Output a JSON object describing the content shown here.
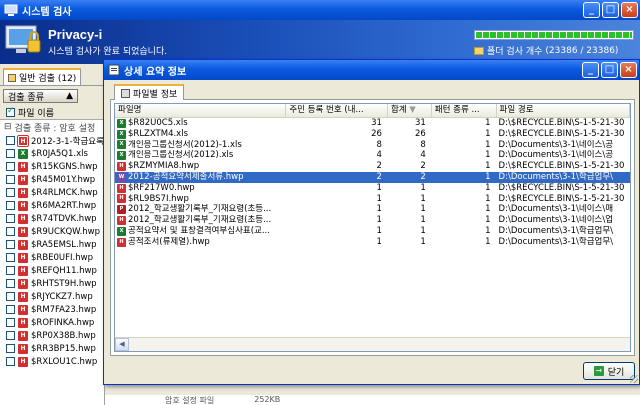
{
  "main_window": {
    "title": "시스템 검사",
    "buttons": [
      "_",
      "□",
      "×"
    ]
  },
  "banner": {
    "app_name": "Privacy-i",
    "status": "시스템 검사가 완료 되었습니다.",
    "progress_fraction": 1.0,
    "folder_count_label": "폴더 검사 개수",
    "folder_count_value": "(23386 / 23386)"
  },
  "left_panel": {
    "tab_label": "일반 검출 (12)",
    "sort_button": "검출 종류",
    "check_label": "파일 이름",
    "group_label": "검출 종류 : 암호 설정",
    "items": [
      {
        "name": "2012-3-1-학급요록.",
        "type": "hwp2"
      },
      {
        "name": "$R0JA5Q1.xls",
        "type": "xls"
      },
      {
        "name": "$R15KGNS.hwp",
        "type": "hwp"
      },
      {
        "name": "$R45M01Y.hwp",
        "type": "hwp"
      },
      {
        "name": "$R4RLMCK.hwp",
        "type": "hwp"
      },
      {
        "name": "$R6MA2RT.hwp",
        "type": "hwp"
      },
      {
        "name": "$R74TDVK.hwp",
        "type": "hwp"
      },
      {
        "name": "$R9UCKQW.hwp",
        "type": "hwp"
      },
      {
        "name": "$RA5EMSL.hwp",
        "type": "hwp"
      },
      {
        "name": "$RBE0UFI.hwp",
        "type": "hwp"
      },
      {
        "name": "$REFQH11.hwp",
        "type": "hwp"
      },
      {
        "name": "$RHTST9H.hwp",
        "type": "hwp"
      },
      {
        "name": "$RJYCKZ7.hwp",
        "type": "hwp"
      },
      {
        "name": "$RM7FA23.hwp",
        "type": "hwp"
      },
      {
        "name": "$ROFINKA.hwp",
        "type": "hwp"
      },
      {
        "name": "$RP0X38B.hwp",
        "type": "hwp"
      },
      {
        "name": "$RR3BP15.hwp",
        "type": "hwp"
      },
      {
        "name": "$RXLOU1C.hwp",
        "type": "hwp"
      }
    ]
  },
  "bottom_strip": {
    "col_a": "암호 설정 파일",
    "col_b": "252KB"
  },
  "dialog": {
    "title": "상세 요약 정보",
    "tab_label": "파일별 정보",
    "columns": [
      "파일명",
      "주민 등록 번호 (내...",
      "합계",
      "패턴 종류 ...",
      "파일 경로"
    ],
    "rows": [
      {
        "name": "$R82U0C5.xls",
        "type": "xls",
        "resident": "31",
        "total": "31",
        "pattern": "1",
        "path": "D:\\$RECYCLE.BIN\\S-1-5-21-30"
      },
      {
        "name": "$RLZXTM4.xls",
        "type": "xls",
        "resident": "26",
        "total": "26",
        "pattern": "1",
        "path": "D:\\$RECYCLE.BIN\\S-1-5-21-30"
      },
      {
        "name": "개인응그룹신청서(2012)-1.xls",
        "type": "xls",
        "resident": "8",
        "total": "8",
        "pattern": "1",
        "path": "D:\\Documents\\3-1\\네이스\\공"
      },
      {
        "name": "개인응그룹신청서(2012).xls",
        "type": "xls",
        "resident": "4",
        "total": "4",
        "pattern": "1",
        "path": "D:\\Documents\\3-1\\네이스\\공"
      },
      {
        "name": "$RZMYMIA8.hwp",
        "type": "hwp",
        "resident": "2",
        "total": "2",
        "pattern": "1",
        "path": "D:\\$RECYCLE.BIN\\S-1-5-21-30"
      },
      {
        "name": "2012-공적요약서제출서류.hwp",
        "type": "doc",
        "resident": "2",
        "total": "2",
        "pattern": "1",
        "path": "D:\\Documents\\3-1\\학급업무\\",
        "selected": true
      },
      {
        "name": "$RF217W0.hwp",
        "type": "hwp",
        "resident": "1",
        "total": "1",
        "pattern": "1",
        "path": "D:\\$RECYCLE.BIN\\S-1-5-21-30"
      },
      {
        "name": "$RL9BS7I.hwp",
        "type": "hwp",
        "resident": "1",
        "total": "1",
        "pattern": "1",
        "path": "D:\\$RECYCLE.BIN\\S-1-5-21-30"
      },
      {
        "name": "2012_학교생활기록부_기재요령(초등...",
        "type": "pdf",
        "resident": "1",
        "total": "1",
        "pattern": "1",
        "path": "D:\\Documents\\3-1\\네이스\\매"
      },
      {
        "name": "2012_학교생활기록부_기재요령(초등...",
        "type": "hwp",
        "resident": "1",
        "total": "1",
        "pattern": "1",
        "path": "D:\\Documents\\3-1\\네이스\\업"
      },
      {
        "name": "공적요약서 및 표창결격여부심사표(교...",
        "type": "xls",
        "resident": "1",
        "total": "1",
        "pattern": "1",
        "path": "D:\\Documents\\3-1\\학급업무\\"
      },
      {
        "name": "공적조서(류제열).hwp",
        "type": "hwp",
        "resident": "1",
        "total": "1",
        "pattern": "1",
        "path": "D:\\Documents\\3-1\\학급업무\\"
      }
    ],
    "ok_button": "닫기"
  }
}
